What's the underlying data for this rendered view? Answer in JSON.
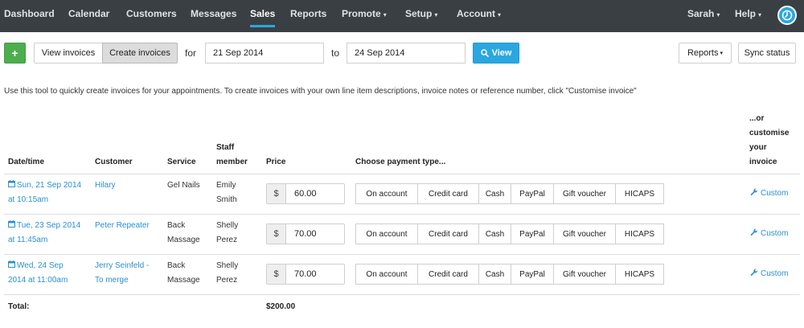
{
  "nav": {
    "items": [
      {
        "label": "Dashboard",
        "caret": false
      },
      {
        "label": "Calendar",
        "caret": false
      },
      {
        "label": "Customers",
        "caret": false
      },
      {
        "label": "Messages",
        "caret": false
      },
      {
        "label": "Sales",
        "caret": false,
        "active": true
      },
      {
        "label": "Reports",
        "caret": false
      },
      {
        "label": "Promote",
        "caret": true
      },
      {
        "label": "Setup",
        "caret": true
      },
      {
        "label": "Account",
        "caret": true
      }
    ],
    "user": "Sarah",
    "help": "Help",
    "caret_glyph": "▾"
  },
  "toolbar": {
    "plus": "+",
    "view_invoices": "View invoices",
    "create_invoices": "Create invoices",
    "for_label": "for",
    "from_date": "21 Sep 2014",
    "to_label": "to",
    "to_date": "24 Sep 2014",
    "view_button": "View",
    "reports_button": "Reports",
    "sync_button": "Sync status"
  },
  "intro_text": "Use this tool to quickly create invoices for your appointments. To create invoices with your own line item descriptions, invoice notes or reference number, click \"Customise invoice\"",
  "table": {
    "headers": {
      "datetime": "Date/time",
      "customer": "Customer",
      "service": "Service",
      "staff_line1": "Staff",
      "staff_line2": "member",
      "price": "Price",
      "payment": "Choose payment type...",
      "custom_line1": "...or",
      "custom_line2": "customise",
      "custom_line3": "your",
      "custom_line4": "invoice"
    },
    "currency_symbol": "$",
    "payment_types": [
      "On account",
      "Credit card",
      "Cash",
      "PayPal",
      "Gift voucher",
      "HICAPS"
    ],
    "custom_label": "Custom",
    "rows": [
      {
        "date_line1": "Sun, 21 Sep 2014",
        "date_line2": "at 10:15am",
        "customer_line1": "Hilary",
        "customer_line2": "",
        "service_line1": "Gel Nails",
        "service_line2": "",
        "staff_line1": "Emily",
        "staff_line2": "Smith",
        "price": "60.00"
      },
      {
        "date_line1": "Tue, 23 Sep 2014",
        "date_line2": "at 11:45am",
        "customer_line1": "Peter Repeater",
        "customer_line2": "",
        "service_line1": "Back",
        "service_line2": "Massage",
        "staff_line1": "Shelly",
        "staff_line2": "Perez",
        "price": "70.00"
      },
      {
        "date_line1": "Wed, 24 Sep",
        "date_line2": "2014 at 11:00am",
        "customer_line1": "Jerry Seinfeld -",
        "customer_line2": "To merge",
        "service_line1": "Back",
        "service_line2": "Massage",
        "staff_line1": "Shelly",
        "staff_line2": "Perez",
        "price": "70.00"
      }
    ],
    "total_label": "Total:",
    "total_value": "$200.00"
  },
  "colors": {
    "nav_bg": "#3a3f44",
    "accent": "#2aa7e0",
    "add_green": "#4cae4c",
    "link": "#2a8fd0"
  }
}
